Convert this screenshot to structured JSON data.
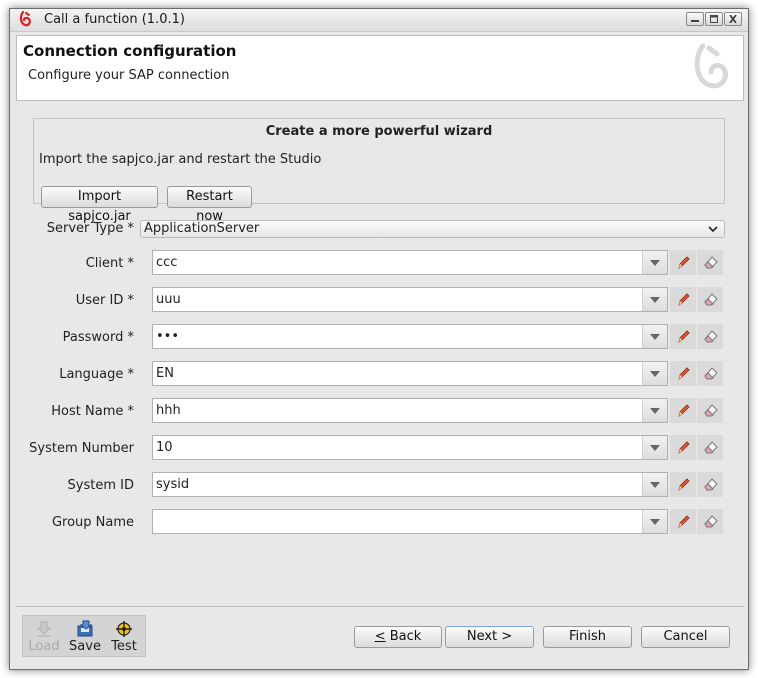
{
  "window": {
    "title": "Call a function (1.0.1)"
  },
  "header": {
    "title": "Connection configuration",
    "subtitle": "Configure your SAP connection"
  },
  "wizard": {
    "title": "Create a more powerful wizard",
    "text": "Import the sapjco.jar and restart the Studio",
    "import_label": "Import sapjco.jar",
    "restart_label": "Restart now"
  },
  "server_type": {
    "label": "Server Type *",
    "value": "ApplicationServer"
  },
  "fields": [
    {
      "label": "Client *",
      "value": "ccc"
    },
    {
      "label": "User ID *",
      "value": "uuu"
    },
    {
      "label": "Password *",
      "value": "•••"
    },
    {
      "label": "Language *",
      "value": "EN"
    },
    {
      "label": "Host Name *",
      "value": "hhh"
    },
    {
      "label": "System Number",
      "value": "10"
    },
    {
      "label": "System ID",
      "value": "sysid"
    },
    {
      "label": "Group Name",
      "value": ""
    }
  ],
  "toolbar": {
    "load": "Load",
    "save": "Save",
    "test": "Test"
  },
  "nav": {
    "back": "< Back",
    "next": "Next >",
    "finish": "Finish",
    "cancel": "Cancel"
  },
  "colors": {
    "accent": "#e11d1d",
    "focus_border": "#7da2ce"
  }
}
